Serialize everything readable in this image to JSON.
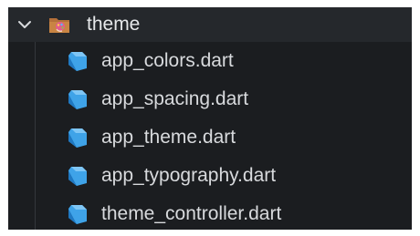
{
  "folder": {
    "name": "theme",
    "expanded": true,
    "chevron_icon": "chevron-down-icon",
    "folder_icon": "theme-folder-icon"
  },
  "files": [
    {
      "name": "app_colors.dart",
      "icon": "dart-file-icon"
    },
    {
      "name": "app_spacing.dart",
      "icon": "dart-file-icon"
    },
    {
      "name": "app_theme.dart",
      "icon": "dart-file-icon"
    },
    {
      "name": "app_typography.dart",
      "icon": "dart-file-icon"
    },
    {
      "name": "theme_controller.dart",
      "icon": "dart-file-icon"
    }
  ],
  "colors": {
    "background": "#1b1d20",
    "folder_row_background": "#25282c",
    "text": "#d8dadd",
    "dart_icon": "#3fa3e8"
  }
}
